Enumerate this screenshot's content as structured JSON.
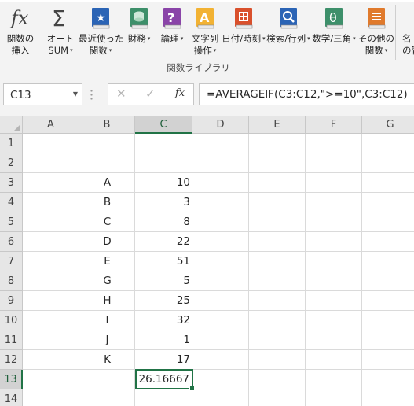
{
  "ribbon": {
    "buttons": [
      {
        "name": "insert-function",
        "line1": "関数の",
        "line2": "挿入",
        "dropdown": false,
        "icon": "fx-icon"
      },
      {
        "name": "autosum",
        "line1": "オート",
        "line2": "SUM",
        "dropdown": true,
        "icon": "sigma-icon"
      },
      {
        "name": "recently-used",
        "line1": "最近使った",
        "line2": "関数",
        "dropdown": true,
        "icon": "star-book-icon"
      },
      {
        "name": "financial",
        "line1": "財務",
        "line2": "",
        "dropdown": true,
        "icon": "coins-icon"
      },
      {
        "name": "logical",
        "line1": "論理",
        "line2": "",
        "dropdown": true,
        "icon": "question-book-icon"
      },
      {
        "name": "text",
        "line1": "文字列",
        "line2": "操作",
        "dropdown": true,
        "icon": "text-a-icon"
      },
      {
        "name": "date-time",
        "line1": "日付/時刻",
        "line2": "",
        "dropdown": true,
        "icon": "calendar-icon"
      },
      {
        "name": "lookup",
        "line1": "検索/行列",
        "line2": "",
        "dropdown": true,
        "icon": "magnifier-book-icon"
      },
      {
        "name": "math-trig",
        "line1": "数学/三角",
        "line2": "",
        "dropdown": true,
        "icon": "theta-book-icon"
      },
      {
        "name": "more-functions",
        "line1": "その他の",
        "line2": "関数",
        "dropdown": true,
        "icon": "more-book-icon"
      },
      {
        "name": "name-manager",
        "line1": "名",
        "line2": "の管",
        "dropdown": false,
        "icon": "name-manager-icon"
      }
    ],
    "group_label": "関数ライブラリ"
  },
  "formula_bar": {
    "name_box": "C13",
    "cancel_glyph": "✕",
    "enter_glyph": "✓",
    "fx_glyph": "fx",
    "formula": "=AVERAGEIF(C3:C12,\">=10\",C3:C12)"
  },
  "grid": {
    "columns": [
      "A",
      "B",
      "C",
      "D",
      "E",
      "F",
      "G"
    ],
    "rows": [
      "1",
      "2",
      "3",
      "4",
      "5",
      "6",
      "7",
      "8",
      "9",
      "10",
      "11",
      "12",
      "13",
      "14"
    ],
    "selected_column": "C",
    "selected_row": "13",
    "data_rows": [
      {
        "row": "3",
        "label": "A",
        "value": "10"
      },
      {
        "row": "4",
        "label": "B",
        "value": "3"
      },
      {
        "row": "5",
        "label": "C",
        "value": "8"
      },
      {
        "row": "6",
        "label": "D",
        "value": "22"
      },
      {
        "row": "7",
        "label": "E",
        "value": "51"
      },
      {
        "row": "8",
        "label": "G",
        "value": "5"
      },
      {
        "row": "9",
        "label": "H",
        "value": "25"
      },
      {
        "row": "10",
        "label": "I",
        "value": "32"
      },
      {
        "row": "11",
        "label": "J",
        "value": "1"
      },
      {
        "row": "12",
        "label": "K",
        "value": "17"
      }
    ],
    "result_cell": {
      "ref": "C13",
      "value": "26.16667"
    }
  },
  "colors": {
    "accent": "#217346",
    "ribbon_bg": "#f3f3f3",
    "header_bg": "#e6e6e6"
  }
}
